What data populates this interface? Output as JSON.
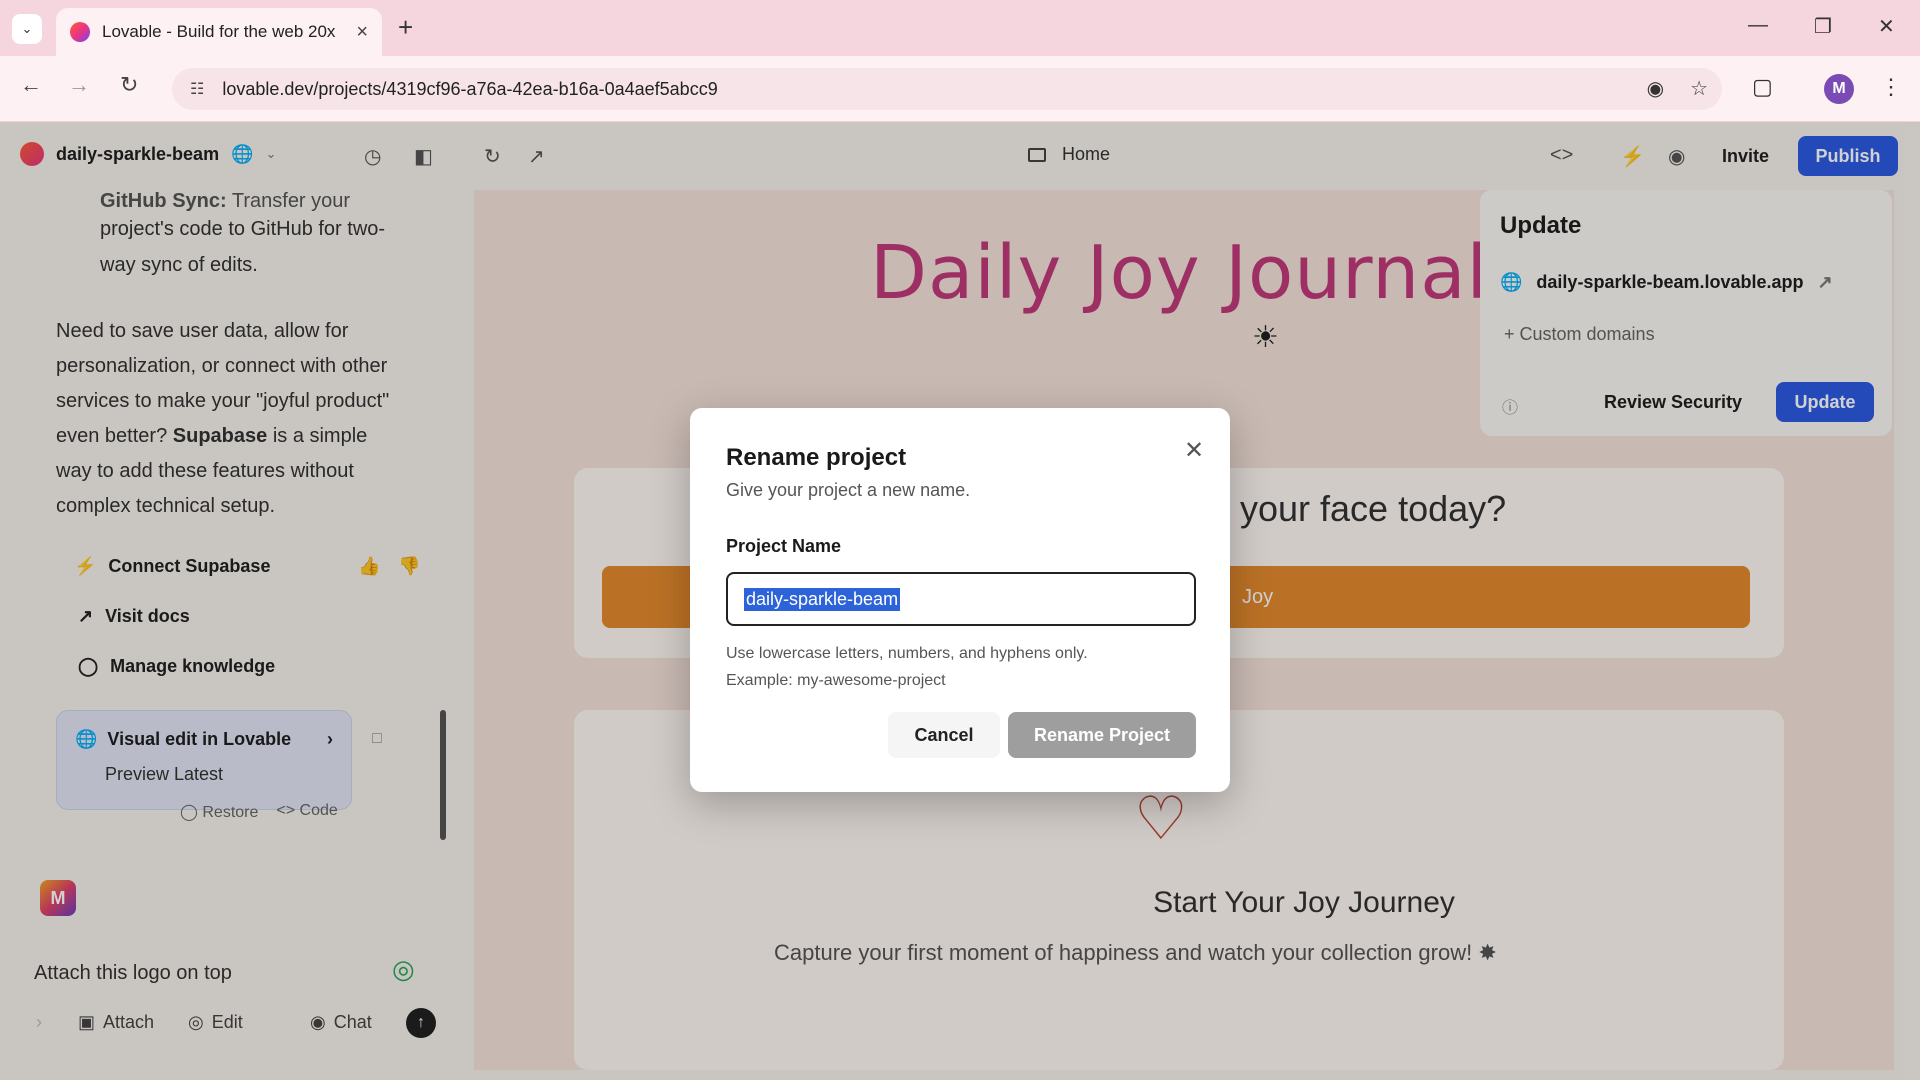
{
  "browser": {
    "tab_title": "Lovable - Build for the web 20x",
    "url": "lovable.dev/projects/4319cf96-a76a-42ea-b16a-0a4aef5abcc9",
    "profile_initial": "M"
  },
  "topbar": {
    "project_name": "daily-sparkle-beam",
    "home_label": "Home",
    "invite_label": "Invite",
    "publish_label": "Publish"
  },
  "chat": {
    "partial_heading": "GitHub Sync:",
    "partial_heading_rest": "Transfer your",
    "line_github_1": "project's code to GitHub for two-",
    "line_github_2": "way sync of edits.",
    "para_1": "Need to save user data, allow for",
    "para_2": "personalization, or connect with other",
    "para_3": "services to make your \"joyful product\"",
    "para_4_bold": "even better?",
    "para_4_strong": "Supabase",
    "para_4_rest": "is a simple",
    "para_5": "way to add these features without",
    "para_6": "complex technical setup.",
    "action_connect": "Connect Supabase",
    "action_docs": "Visit docs",
    "action_knowledge": "Manage knowledge",
    "card_title": "Visual edit in Lovable",
    "card_sub": "Preview Latest",
    "card_restore": "Restore",
    "card_code": "Code",
    "user_initial": "M",
    "input_text": "Attach this logo on top",
    "attach_label": "Attach",
    "edit_label": "Edit",
    "chat_label": "Chat"
  },
  "preview": {
    "title": "Daily Joy Journal",
    "question": "your face today?",
    "bar_text": "Joy",
    "journey_title": "Start Your Joy Journey",
    "capture_text": "Capture your first moment of happiness and watch your collection grow!"
  },
  "update_panel": {
    "heading": "Update",
    "site": "daily-sparkle-beam.lovable.app",
    "custom_domains": "Custom domains",
    "review_security": "Review Security",
    "update_button": "Update"
  },
  "dialog": {
    "title": "Rename project",
    "subtitle": "Give your project a new name.",
    "field_label": "Project Name",
    "field_value": "daily-sparkle-beam",
    "hint_1": "Use lowercase letters, numbers, and hyphens only.",
    "hint_2": "Example: my-awesome-project",
    "cancel_label": "Cancel",
    "rename_label": "Rename Project"
  },
  "colors": {
    "accent_blue": "#2d5be3",
    "title_pink": "#c13a7a",
    "bar_orange": "#e38a2e"
  }
}
